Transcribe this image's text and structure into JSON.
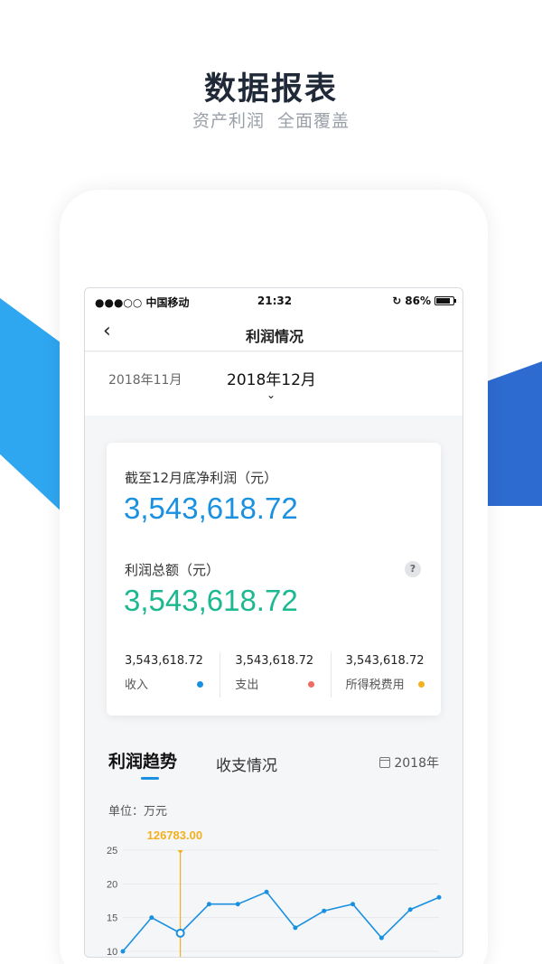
{
  "promo": {
    "title": "数据报表",
    "subtitle_parts": [
      "资产利润",
      "全面覆盖"
    ]
  },
  "status_bar": {
    "carrier": "●●●○○ 中国移动",
    "time": "21:32",
    "battery": "86%",
    "battery_level": 0.86
  },
  "nav": {
    "back_icon": "chevron-left-icon",
    "title": "利润情况"
  },
  "months": {
    "previous": "2018年11月",
    "current": "2018年12月"
  },
  "summary": {
    "net_profit_label": "截至12月底净利润（元）",
    "net_profit_value": "3,543,618.72",
    "total_profit_label": "利润总额（元）",
    "total_profit_value": "3,543,618.72",
    "help": "?",
    "breakdown": [
      {
        "value": "3,543,618.72",
        "label": "收入",
        "color": "#1990e0"
      },
      {
        "value": "3,543,618.72",
        "label": "支出",
        "color": "#ef6b62"
      },
      {
        "value": "3,543,618.72",
        "label": "所得税费用",
        "color": "#f2b01e"
      }
    ]
  },
  "tabs": {
    "active": "利润趋势",
    "inactive": "收支情况",
    "year": "2018年"
  },
  "unit_label": "单位：万元",
  "colors": {
    "accent": "#1990e0",
    "green": "#1cb88f",
    "highlight": "#f2b01e"
  },
  "chart_data": {
    "type": "line",
    "x": [
      1,
      2,
      3,
      4,
      5,
      6,
      7,
      8,
      9,
      10,
      11,
      12
    ],
    "values": [
      10,
      15,
      12.7,
      17,
      17,
      18.8,
      13.5,
      16,
      17,
      12,
      16.2,
      18
    ],
    "ylim": [
      10,
      25
    ],
    "yticks": [
      10,
      15,
      20,
      25
    ],
    "grid": true,
    "highlight_index": 2,
    "highlight_label": "126783.00"
  }
}
